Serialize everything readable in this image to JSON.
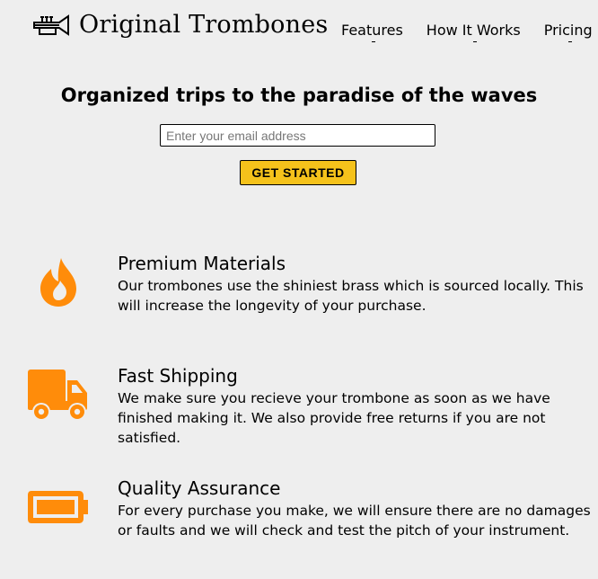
{
  "header": {
    "logo_text": "Original Trombones",
    "nav": [
      {
        "label": "Features"
      },
      {
        "label": "How It Works"
      },
      {
        "label": "Pricing"
      }
    ]
  },
  "hero": {
    "title": "Organized trips to the paradise of the waves",
    "email_placeholder": "Enter your email address",
    "cta_label": "GET STARTED"
  },
  "features": [
    {
      "icon": "fire-icon",
      "title": "Premium Materials",
      "description": "Our trombones use the shiniest brass which is sourced locally. This will increase the longevity of your purchase."
    },
    {
      "icon": "truck-icon",
      "title": "Fast Shipping",
      "description": "We make sure you recieve your trombone as soon as we have finished making it. We also provide free returns if you are not satisfied."
    },
    {
      "icon": "battery-full-icon",
      "title": "Quality Assurance",
      "description": "For every purchase you make, we will ensure there are no damages or faults and we will check and test the pitch of your instrument."
    }
  ],
  "colors": {
    "accent": "#f5c21b",
    "icon": "#ff8c0a",
    "background": "#eeeeee"
  }
}
